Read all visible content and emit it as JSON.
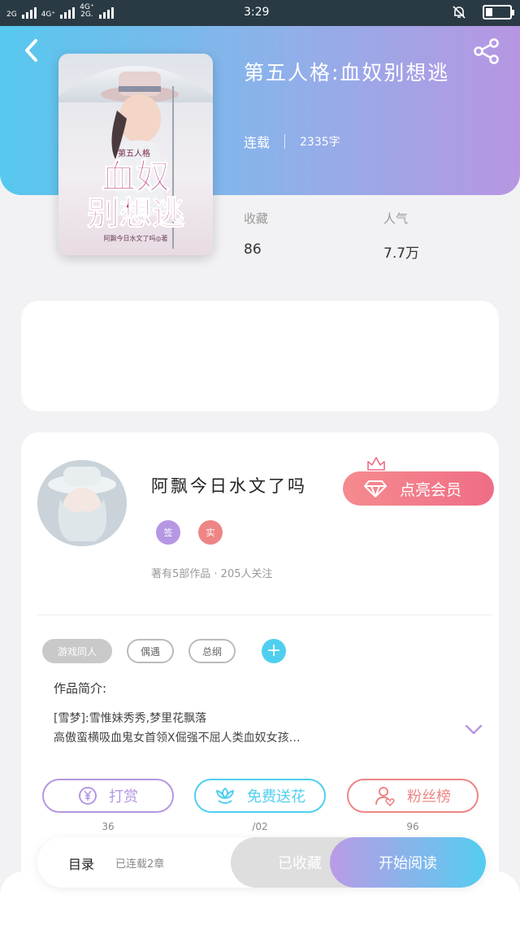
{
  "status_bar": {
    "net1": "2G",
    "net2_top": "4G⁺",
    "net3_top": "4G⁺",
    "net3_bottom": "2G.",
    "time": "3:29",
    "battery_level": 0.3
  },
  "book": {
    "title": "第五人格:血奴别想逃",
    "status": "连载",
    "word_count": "2335字",
    "cover": {
      "series_text": "第五人格",
      "title_line1": "血奴",
      "title_line2": "别想逃",
      "author_line": "阿飘今日水文了吗◎著"
    }
  },
  "stats": {
    "favorites_label": "收藏",
    "favorites_value": "86",
    "popularity_label": "人气",
    "popularity_value": "7.7万"
  },
  "author": {
    "name": "阿飘今日水文了吗",
    "badge_sign": "签",
    "badge_real": "实",
    "works_info": "著有5部作品 · 205人关注",
    "vip_label": "点亮会员"
  },
  "tags": [
    "游戏同人",
    "偶遇",
    "总纲"
  ],
  "intro": {
    "heading": "作品简介:",
    "line1": "[雪梦]:雪惟妹秀秀,梦里花飘落",
    "line2": "高傲蛮横吸血鬼女首领X倔强不屈人类血奴女孩…"
  },
  "actions": {
    "reward_label": "打赏",
    "reward_count": "36",
    "flower_label": "免费送花",
    "flower_count": "/02",
    "fans_label": "粉丝榜",
    "fans_count": "96"
  },
  "bottom_bar": {
    "toc_label": "目录",
    "updated_label": "已连载2章",
    "favorited_label": "已收藏",
    "read_label": "开始阅读"
  },
  "colors": {
    "hero_start": "#56c8ee",
    "hero_end": "#b796e2",
    "vip_pink": "#ef6d86",
    "reward_purple": "#b597e3",
    "flower_cyan": "#4fcff0",
    "fans_coral": "#ee8585"
  },
  "icons": {
    "back": "chevron-left-icon",
    "share": "share-icon",
    "vip": "diamond-icon",
    "reward": "yen-coin-icon",
    "flower": "flower-icon",
    "fans": "user-heart-icon",
    "expand": "chevron-down-icon",
    "add_tag": "plus-icon"
  }
}
